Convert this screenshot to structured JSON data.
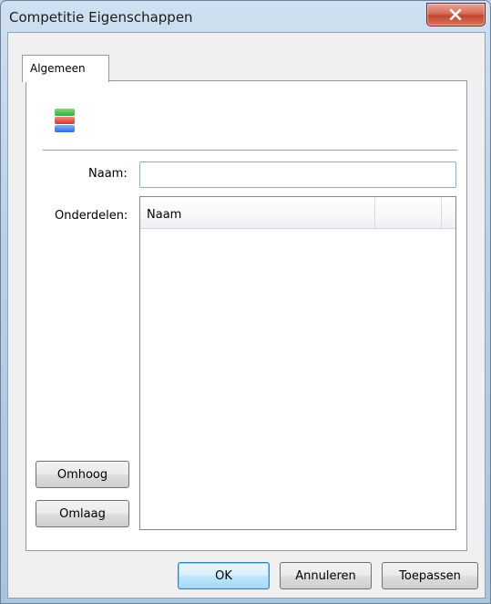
{
  "window": {
    "title": "Competitie Eigenschappen",
    "close_icon": "close-x-icon"
  },
  "tabs": [
    {
      "label": "Algemeen",
      "selected": true
    }
  ],
  "general": {
    "icon": "competition-stack-icon",
    "icon_colors": [
      "#2fae3e",
      "#d9342b",
      "#2f6fd6"
    ],
    "name_label": "Naam:",
    "name_value": "",
    "parts_label": "Onderdelen:",
    "parts_columns": [
      "Naam",
      "",
      ""
    ],
    "parts_rows": [],
    "up_button": "Omhoog",
    "down_button": "Omlaag"
  },
  "footer": {
    "ok": "OK",
    "cancel": "Annuleren",
    "apply": "Toepassen"
  }
}
